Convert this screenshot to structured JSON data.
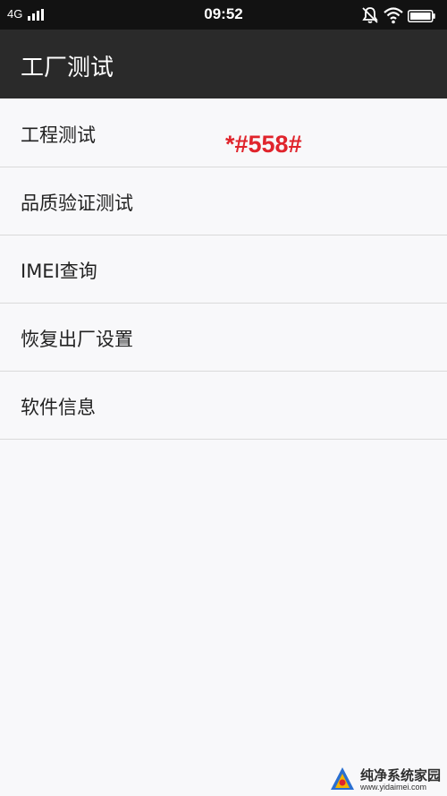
{
  "status_bar": {
    "network": "4G",
    "time": "09:52"
  },
  "app_bar": {
    "title": "工厂测试"
  },
  "menu": {
    "items": [
      {
        "label": "工程测试"
      },
      {
        "label": "品质验证测试"
      },
      {
        "label": "IMEI查询"
      },
      {
        "label": "恢复出厂设置"
      },
      {
        "label": "软件信息"
      }
    ]
  },
  "annotation": "*#558#",
  "watermark": {
    "text": "纯净系统家园",
    "url": "www.yidaimei.com"
  },
  "colors": {
    "status_bar": "#121212",
    "app_bar": "#2a2a2a",
    "annotation": "#e0242c",
    "background": "#f8f8fa"
  }
}
